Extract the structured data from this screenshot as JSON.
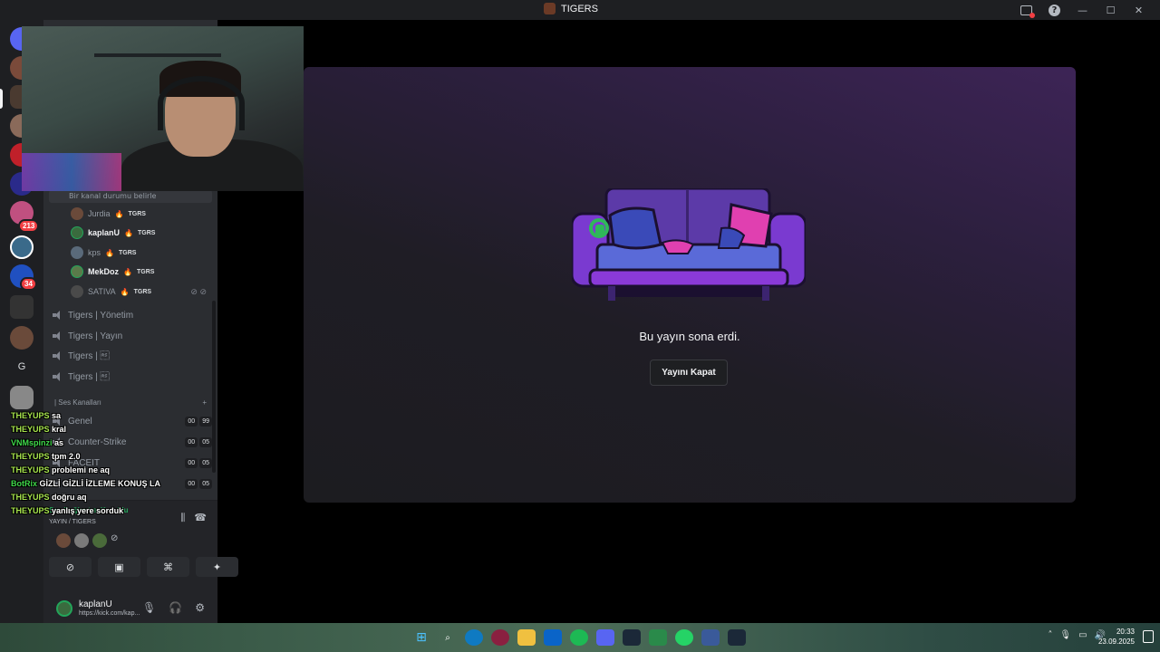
{
  "window": {
    "title": "TIGERS"
  },
  "servers": {
    "badges": [
      "213",
      "34"
    ],
    "letter": "G"
  },
  "sidebar": {
    "status_hint": "Bir kanal durumu belirle",
    "voice_users": [
      {
        "name": "Jurdia",
        "tag": "TGRS"
      },
      {
        "name": "kaplanU",
        "tag": "TGRS"
      },
      {
        "name": "kps",
        "tag": "TGRS"
      },
      {
        "name": "MekDoz",
        "tag": "TGRS"
      },
      {
        "name": "SATIVA",
        "tag": "TGRS"
      }
    ],
    "channels": [
      "Tigers | Yönetim",
      "Tigers | Yayın",
      "Tigers | \u001e",
      "Tigers | \u001e"
    ],
    "category": "| Ses Kanalları",
    "sound_channels": [
      {
        "name": "Genel",
        "counts": [
          "00",
          "99"
        ]
      },
      {
        "name": "Counter-Strike",
        "counts": [
          "00",
          "05"
        ]
      },
      {
        "name": "FACEIT",
        "counts": [
          "00",
          "05"
        ]
      },
      {
        "name": "",
        "counts": [
          "00",
          "05"
        ]
      }
    ]
  },
  "voice_panel": {
    "status": "Ses Bağlantısı Kuruldu",
    "location": "YAYIN / TIGERS"
  },
  "user_panel": {
    "name": "kaplanU",
    "status": "https://kick.com/kap..."
  },
  "chat_overlay": [
    {
      "user": "THEYUPS",
      "msg": "sa"
    },
    {
      "user": "THEYUPS",
      "msg": "kral"
    },
    {
      "user": "VNMspinzi",
      "msg": "as"
    },
    {
      "user": "THEYUPS",
      "msg": "tpm 2.0"
    },
    {
      "user": "THEYUPS",
      "msg": "problemi ne aq"
    },
    {
      "user": "BotRix",
      "msg": "GİZLİ GİZLİ İZLEME KONUŞ LA"
    },
    {
      "user": "THEYUPS",
      "msg": "doğru aq"
    },
    {
      "user": "THEYUPS",
      "msg": "yanlış yere sorduk"
    }
  ],
  "stage": {
    "ended_text": "Bu yayın sona erdi.",
    "close_button": "Yayını Kapat"
  },
  "taskbar": {
    "time": "20:33",
    "date": "23.09.2025"
  },
  "colors": {
    "accent_purple": "#5c3aa8",
    "couch_pink": "#e040b0",
    "online_green": "#23a55a"
  }
}
